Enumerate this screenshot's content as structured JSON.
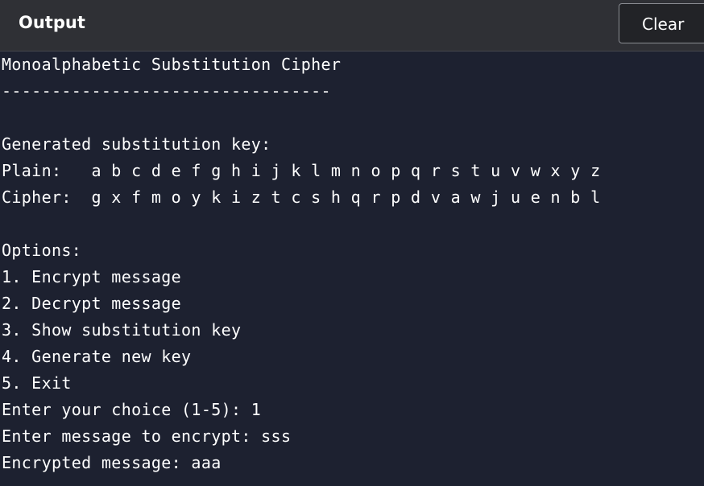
{
  "header": {
    "title": "Output",
    "clear_label": "Clear"
  },
  "colors": {
    "header_bg": "#2f3035",
    "terminal_bg": "#1d2130",
    "text": "#ffffff"
  },
  "console_lines": [
    "Monoalphabetic Substitution Cipher",
    "---------------------------------",
    "",
    "Generated substitution key:",
    "Plain:   a b c d e f g h i j k l m n o p q r s t u v w x y z",
    "Cipher:  g x f m o y k i z t c s h q r p d v a w j u e n b l",
    "",
    "Options:",
    "1. Encrypt message",
    "2. Decrypt message",
    "3. Show substitution key",
    "4. Generate new key",
    "5. Exit",
    "Enter your choice (1-5): 1",
    "Enter message to encrypt: sss",
    "Encrypted message: aaa"
  ]
}
